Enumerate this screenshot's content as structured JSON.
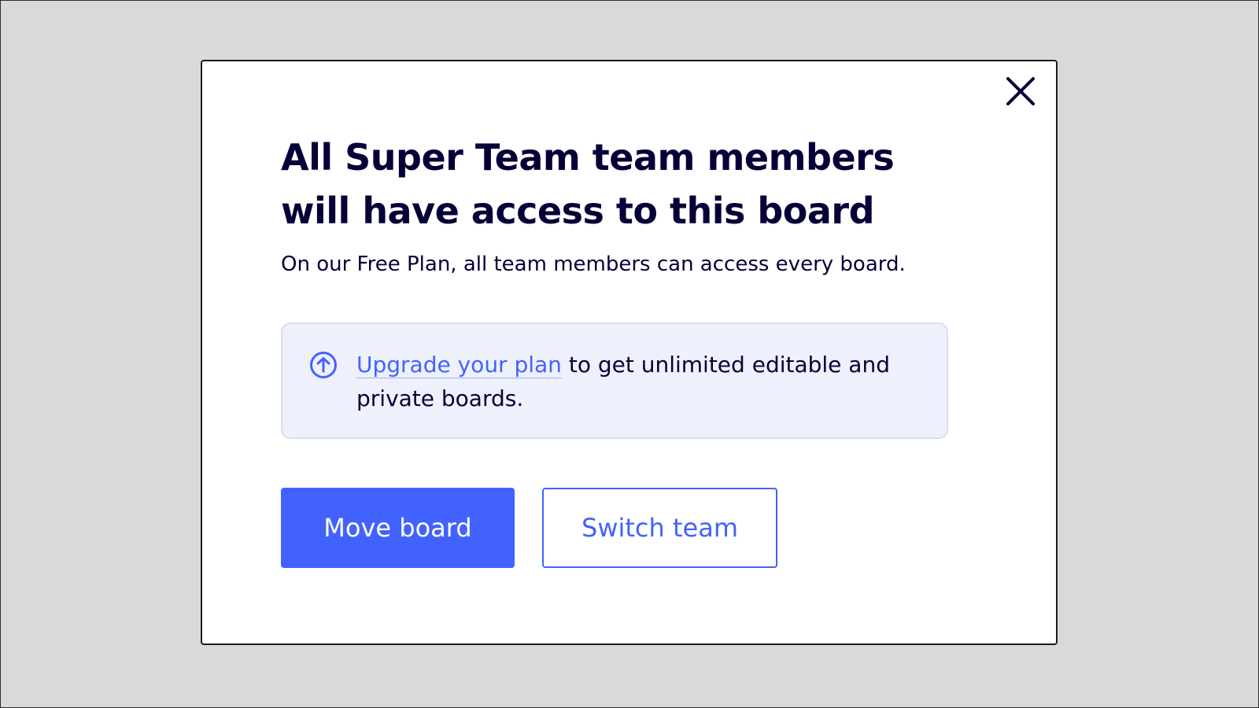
{
  "modal": {
    "title": "All Super Team team members will have access to this board",
    "subtitle": "On our Free Plan, all team members can access every board.",
    "close_icon": "close-icon",
    "callout": {
      "icon": "upgrade-arrow-icon",
      "link_text": "Upgrade your plan",
      "text": " to get unlimited editable and private boards."
    },
    "buttons": {
      "primary_label": "Move board",
      "secondary_label": "Switch team"
    }
  },
  "colors": {
    "background": "#d9d9d9",
    "text": "#050038",
    "accent": "#4262ff",
    "callout_bg": "#eef1fc"
  }
}
